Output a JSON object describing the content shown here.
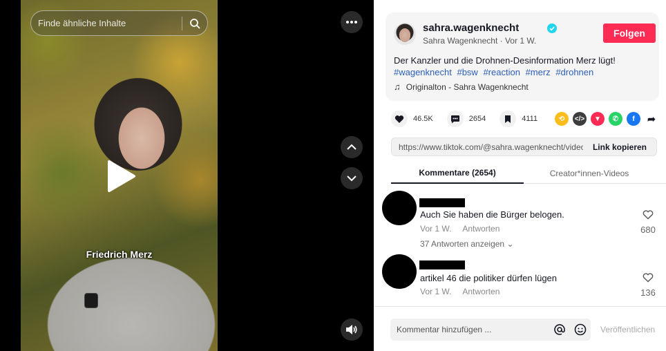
{
  "video": {
    "search_placeholder": "Finde ähnliche Inhalte",
    "caption": "Friedrich Merz"
  },
  "author": {
    "username": "sahra.wagenknecht",
    "display_name": "Sahra Wagenknecht",
    "time_ago": "Vor 1 W.",
    "follow_label": "Folgen",
    "description": "Der Kanzler und die Drohnen-Desinformation Merz lügt!",
    "hashtags": [
      "#wagenknecht",
      "#bsw",
      "#reaction",
      "#merz",
      "#drohnen"
    ],
    "sound": "Originalton - Sahra Wagenknecht"
  },
  "stats": {
    "likes": "46.5K",
    "comments": "2654",
    "saves": "4111"
  },
  "share": {
    "url": "https://www.tiktok.com/@sahra.wagenknecht/video/...",
    "copy_label": "Link kopieren"
  },
  "tabs": {
    "comments": "Kommentare (2654)",
    "creator": "Creator*innen-Videos"
  },
  "comments": [
    {
      "text": "Auch Sie haben die Bürger belogen.",
      "time": "Vor 1 W.",
      "reply": "Antworten",
      "likes": "680",
      "replies": "37 Antworten anzeigen"
    },
    {
      "text": "artikel 46 die politiker dürfen lügen",
      "time": "Vor 1 W.",
      "reply": "Antworten",
      "likes": "136",
      "replies": ""
    }
  ],
  "composer": {
    "placeholder": "Kommentar hinzufügen ...",
    "publish_label": "Veröffentlichen"
  },
  "colors": {
    "follow": "#fe2c55",
    "hashtag": "#2b5db9",
    "verified": "#20d5ec"
  }
}
